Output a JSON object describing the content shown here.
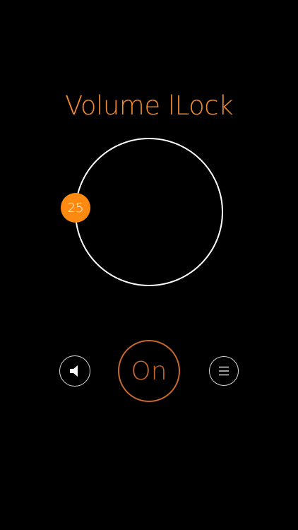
{
  "app": {
    "title": "Volume lLock"
  },
  "dial": {
    "value": "25"
  },
  "controls": {
    "sound_icon": "speaker-icon",
    "menu_icon": "menu-icon",
    "power_label": "On"
  },
  "colors": {
    "accent": "#ff8a12",
    "accent_dim": "#c8692a",
    "dial_ring": "#ffffff",
    "background": "#000000"
  }
}
